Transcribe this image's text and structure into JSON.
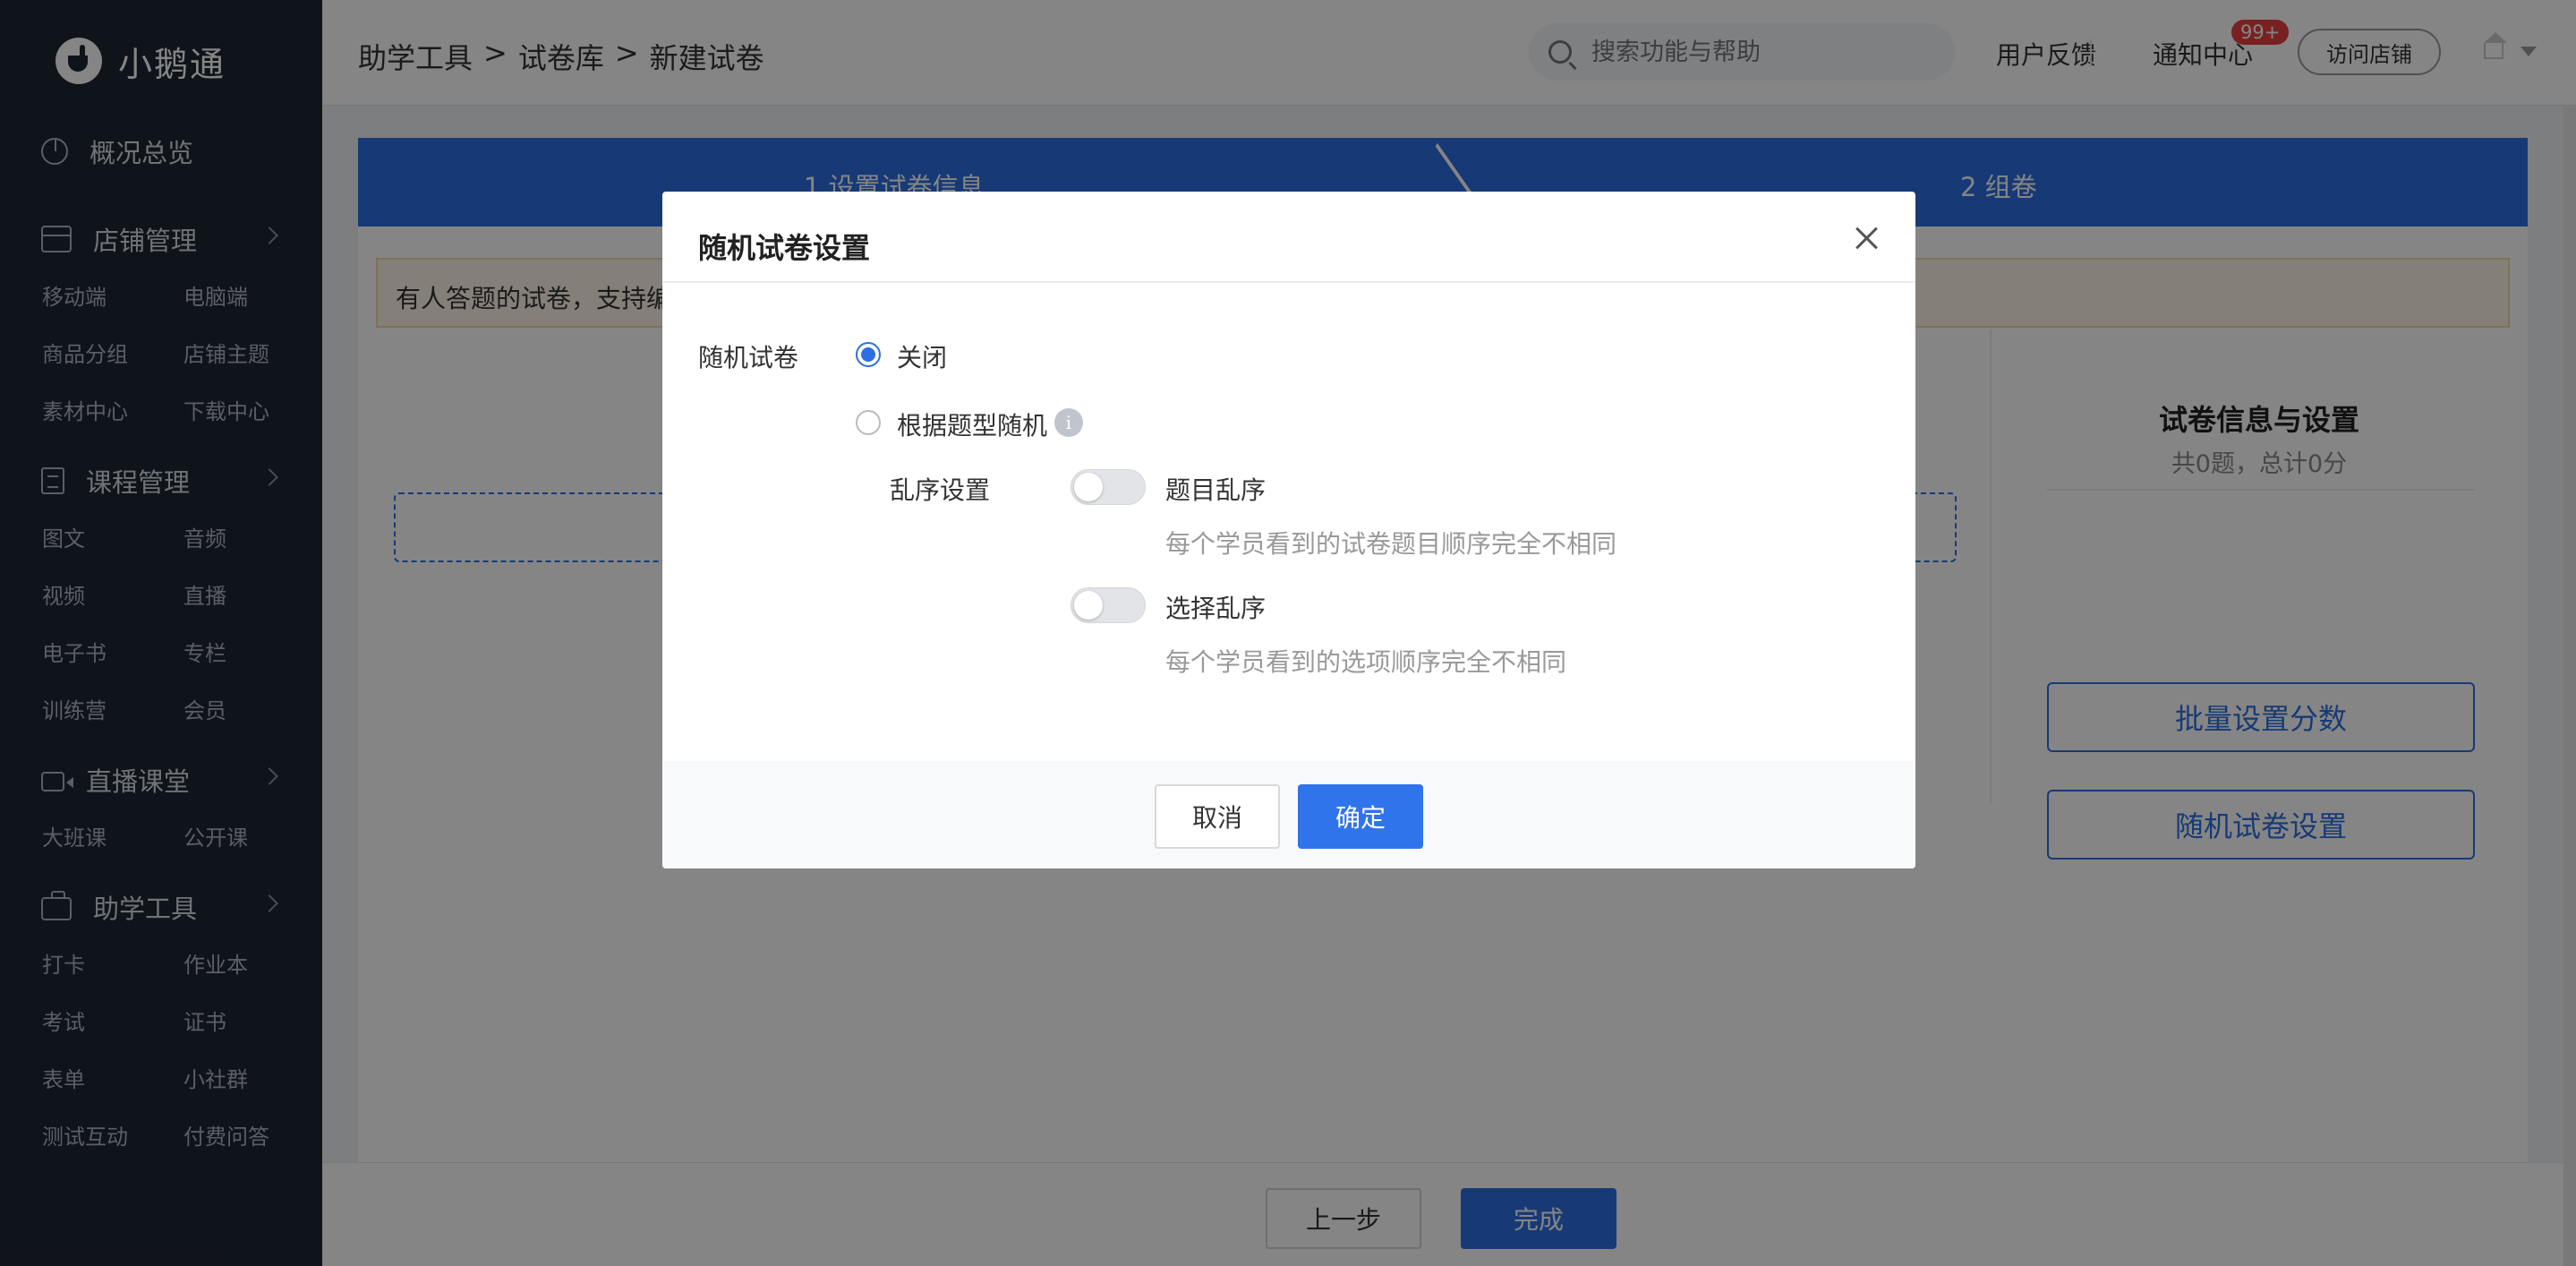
{
  "brand": {
    "name": "小鹅通"
  },
  "sidebar": {
    "overview": "概况总览",
    "shop": {
      "label": "店铺管理",
      "items": [
        "移动端",
        "电脑端",
        "商品分组",
        "店铺主题",
        "素材中心",
        "下载中心"
      ]
    },
    "course": {
      "label": "课程管理",
      "items": [
        "图文",
        "音频",
        "视频",
        "直播",
        "电子书",
        "专栏",
        "训练营",
        "会员"
      ]
    },
    "live": {
      "label": "直播课堂",
      "items": [
        "大班课",
        "公开课"
      ]
    },
    "tools": {
      "label": "助学工具",
      "items": [
        "打卡",
        "作业本",
        "考试",
        "证书",
        "表单",
        "小社群",
        "测试互动",
        "付费问答"
      ]
    }
  },
  "header": {
    "breadcrumb": [
      "助学工具",
      "试卷库",
      "新建试卷"
    ],
    "breadcrumb_sep": ">",
    "search_placeholder": "搜索功能与帮助",
    "feedback": "用户反馈",
    "notifications": "通知中心",
    "notification_badge": "99+",
    "visit_shop": "访问店铺"
  },
  "steps": [
    "1 设置试卷信息",
    "2 组卷"
  ],
  "notice": "有人答题的试卷，支持编",
  "right_panel": {
    "title": "试卷信息与设置",
    "summary": "共0题，总计0分",
    "batch_score": "批量设置分数",
    "random_settings": "随机试卷设置"
  },
  "footer": {
    "prev": "上一步",
    "done": "完成"
  },
  "modal": {
    "title": "随机试卷设置",
    "random_label": "随机试卷",
    "option_off": "关闭",
    "option_by_type": "根据题型随机",
    "info_glyph": "i",
    "shuffle_label": "乱序设置",
    "question_shuffle": "题目乱序",
    "question_shuffle_hint": "每个学员看到的试卷题目顺序完全不相同",
    "option_shuffle": "选择乱序",
    "option_shuffle_hint": "每个学员看到的选项顺序完全不相同",
    "cancel": "取消",
    "confirm": "确定",
    "selected_option": "关闭",
    "question_shuffle_on": false,
    "option_shuffle_on": false
  },
  "colors": {
    "primary": "#2c6fe3",
    "sidebar_bg": "#1e2533",
    "badge": "#e94040",
    "notice_bg": "#fdf6e8"
  }
}
